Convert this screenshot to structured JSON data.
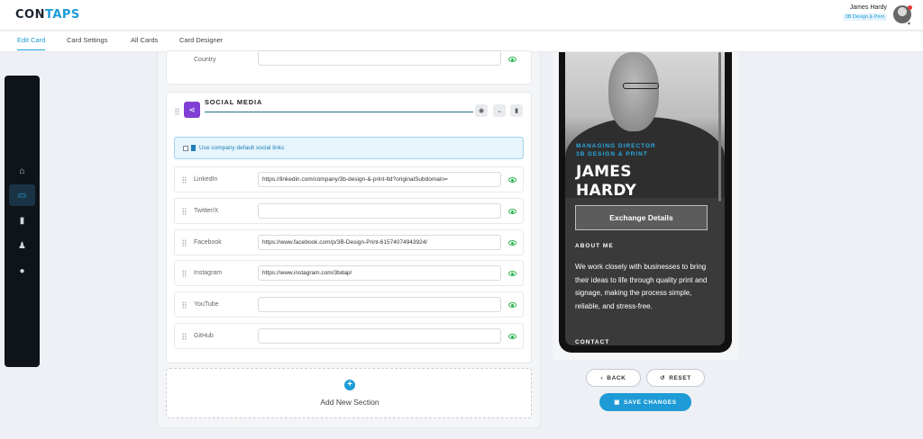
{
  "header": {
    "logo_main": "CON",
    "logo_accent": "TAPS",
    "user_name": "James Hardy",
    "user_company": "3B Design & Print"
  },
  "tabs": [
    {
      "label": "Edit Card",
      "active": true
    },
    {
      "label": "Card Settings",
      "active": false
    },
    {
      "label": "All Cards",
      "active": false
    },
    {
      "label": "Card Designer",
      "active": false
    }
  ],
  "rail": {
    "items": [
      {
        "name": "home-icon",
        "glyph": "⌂"
      },
      {
        "name": "card-icon",
        "glyph": "▭"
      },
      {
        "name": "contact-book-icon",
        "glyph": "▮"
      },
      {
        "name": "users-icon",
        "glyph": "♟"
      },
      {
        "name": "account-icon",
        "glyph": "●"
      }
    ]
  },
  "country": {
    "label": "Country",
    "value": ""
  },
  "social_media": {
    "title": "SOCIAL MEDIA",
    "company_default_label": "Use company default social links",
    "fields": [
      {
        "label": "LinkedIn",
        "value": "https://linkedin.com/company/3b-design-&-print-ltd?originalSubdomain="
      },
      {
        "label": "Twitter/X",
        "value": ""
      },
      {
        "label": "Facebook",
        "value": "https://www.facebook.com/p/3B-Design-Print-61574074943924/"
      },
      {
        "label": "Instagram",
        "value": "https://www.instagram.com/3bdap/"
      },
      {
        "label": "YouTube",
        "value": ""
      },
      {
        "label": "GitHub",
        "value": ""
      }
    ]
  },
  "add_section": {
    "label": "Add New Section"
  },
  "preview": {
    "role_line1": "MANAGING DIRECTOR",
    "role_line2": "3B DESIGN & PRINT",
    "first_name": "JAMES",
    "last_name": "HARDY",
    "exchange_label": "Exchange Details",
    "about_heading": "ABOUT ME",
    "about_text": "We work closely with businesses to bring their ideas to life through quality print and signage, making the process simple, reliable, and stress-free.",
    "contact_heading": "CONTACT"
  },
  "actions": {
    "back_label": "BACK",
    "reset_label": "RESET",
    "save_label": "SAVE CHANGES"
  },
  "colors": {
    "accent": "#1e9bd7",
    "social_icon_bg": "#7f3fd4",
    "visible_eye": "#2bb24c",
    "rail_bg": "#0f1419"
  }
}
